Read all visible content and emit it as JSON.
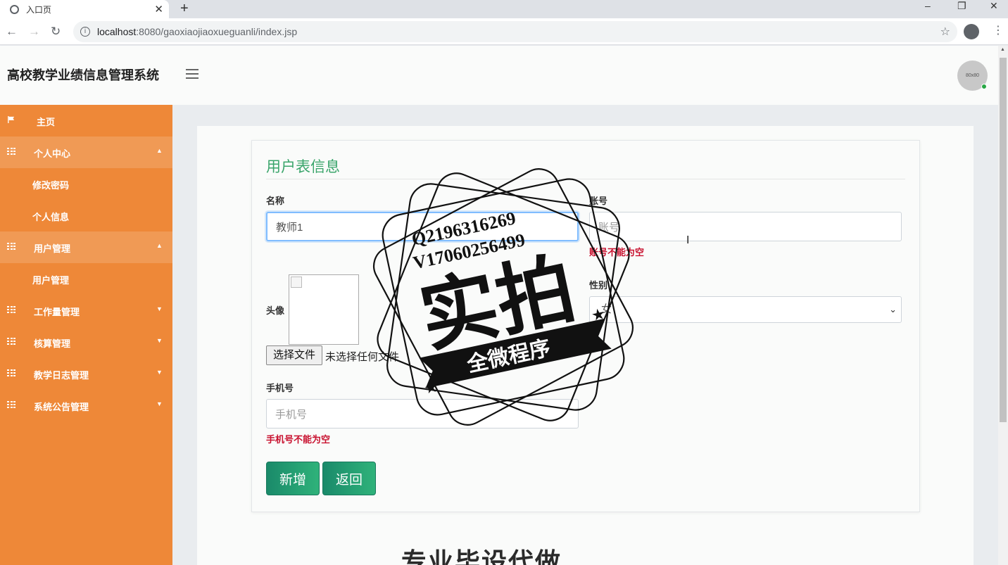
{
  "browser": {
    "tab_title": "入口页",
    "tab_close": "✕",
    "new_tab": "+",
    "url_host": "localhost",
    "url_rest": ":8080/gaoxiaojiaoxueguanli/index.jsp",
    "window_min": "–",
    "window_restore": "❐",
    "window_close": "✕"
  },
  "header": {
    "app_title": "高校教学业绩信息管理系统",
    "avatar_text": "80x80"
  },
  "sidebar": {
    "items": [
      {
        "label": "主页",
        "icon": "flag-icon",
        "type": "home"
      },
      {
        "label": "个人中心",
        "icon": "grid-icon",
        "type": "parent-open",
        "caret": "▲"
      },
      {
        "label": "修改密码",
        "type": "child"
      },
      {
        "label": "个人信息",
        "type": "child"
      },
      {
        "label": "用户管理",
        "icon": "grid-icon",
        "type": "parent-open",
        "caret": "▲"
      },
      {
        "label": "用户管理",
        "type": "child"
      },
      {
        "label": "工作量管理",
        "icon": "grid-icon",
        "type": "parent",
        "caret": "▼"
      },
      {
        "label": "核算管理",
        "icon": "grid-icon",
        "type": "parent",
        "caret": "▼"
      },
      {
        "label": "教学日志管理",
        "icon": "grid-icon",
        "type": "parent",
        "caret": "▼"
      },
      {
        "label": "系统公告管理",
        "icon": "grid-icon",
        "type": "parent",
        "caret": "▼"
      }
    ]
  },
  "form": {
    "title": "用户表信息",
    "name_label": "名称",
    "name_value": "教师1",
    "account_label": "账号",
    "account_placeholder": "账号",
    "account_error": "账号不能为空",
    "avatar_label": "头像",
    "file_button": "选择文件",
    "file_status": "未选择任何文件",
    "gender_label": "性别",
    "gender_value": "女",
    "phone_label": "手机号",
    "phone_placeholder": "手机号",
    "phone_error": "手机号不能为空",
    "add_button": "新增",
    "back_button": "返回"
  },
  "watermark": {
    "line1": "Q2196316269",
    "line2": "V17060256499",
    "big": "实拍",
    "ribbon": "全微程序",
    "bottom": "专业毕设代做"
  },
  "colors": {
    "sidebar": "#ee8838",
    "accent": "#3aa56b",
    "error": "#c8102e"
  }
}
